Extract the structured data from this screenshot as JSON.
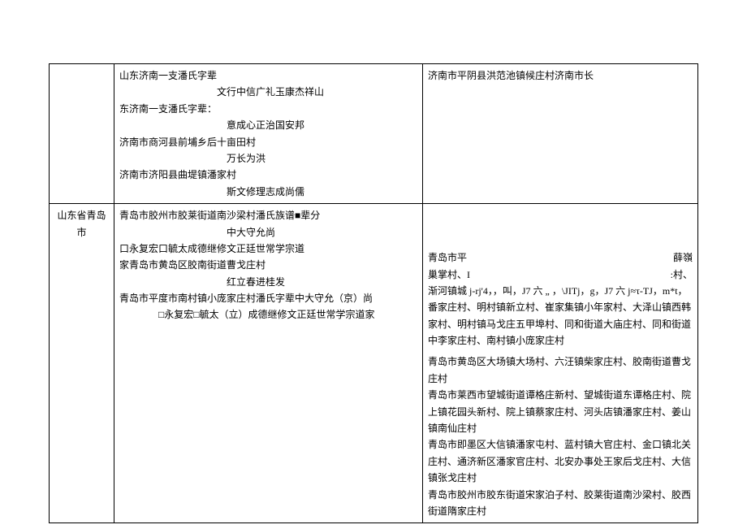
{
  "row1": {
    "colA": "",
    "colB": {
      "l1": "山东济南一支潘氏字辈",
      "l2": "文行中信广礼玉康杰祥山",
      "l3": "东济南一支潘氏字辈：",
      "l4": "意成心正治国安邦",
      "l5": "济南市商河县前埔乡后十亩田村",
      "l6": "万长为洪",
      "l7": "济南市济阳县曲堤镇潘家村",
      "l8": "斯文修理志成尚儒"
    },
    "colC": "济南市平阴县洪范池镇候庄村济南市长"
  },
  "row2": {
    "colA": "山东省青岛市",
    "colB": {
      "l1": "青岛市胶州市胶莱街道南沙梁村潘氏族谱■辈分",
      "l2": "中大守允尚",
      "l3": "口永复宏口毓太成德继修文正廷世常学宗道",
      "l4": "家青岛市黄岛区胶南街道曹戈庄村",
      "l5": "红立春进桂发",
      "l6": "青岛市平度市南村镇小庞家庄村潘氏字辈中大守允（京）尚",
      "l7": "□永复宏□毓太（立）成德继修文正廷世常学宗道家"
    },
    "colC": {
      "p1a": "青岛市平",
      "p1b": "薛嶺",
      "p2a": "巢掌村、I",
      "p2b": ":村、",
      "p3": "渐河镇城 j-rj'4，，叫，J7 六 „ ，\\JITj，g，J7 六 j≈τ-TJ，m*t，番家庄村、明村镇新立村、崔家集镇小年家村、大泽山镇西韩家村、明村镇马戈庄五甲埠村、同和街道大庙庄村、同和街道中李家庄村、南村镇小庞家庄村",
      "p4": "青岛市黄岛区大场镇大场村、六汪镇柴家庄村、胶南街道曹戈庄村",
      "p5": "青岛市莱西市望城街道谭格庄新村、望城街道东谭格庄村、院上镇花园头新村、院上镇蔡家庄村、河头店镇潘家庄村、姜山镇南仙庄村",
      "p6": "青岛市即墨区大信镇潘家屯村、蓝村镇大官庄村、金口镇北关庄村、通济新区潘家官庄村、北安办事处王家后戈庄村、大信镇张戈庄村",
      "p7": "青岛市胶州市胶东街道宋家泊子村、胶莱街道南沙梁村、胶西街道隋家庄村"
    }
  }
}
